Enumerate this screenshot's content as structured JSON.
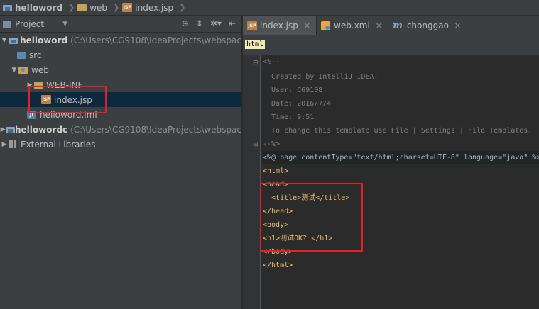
{
  "breadcrumb": {
    "items": [
      {
        "label": "helloword",
        "icon": "project-icon"
      },
      {
        "label": "web",
        "icon": "folder-icon"
      },
      {
        "label": "index.jsp",
        "icon": "jsp-file-icon"
      }
    ]
  },
  "project_panel": {
    "title": "Project",
    "tree": [
      {
        "label": "helloword",
        "path": "(C:\\Users\\CG9108\\IdeaProjects\\webspac",
        "expanded": true
      },
      {
        "label": "src"
      },
      {
        "label": "web",
        "expanded": true
      },
      {
        "label": "WEB-INF",
        "expanded": false
      },
      {
        "label": "index.jsp",
        "selected": true
      },
      {
        "label": "helloword.iml"
      },
      {
        "label": "hellowordc",
        "path": "(C:\\Users\\CG9108\\IdeaProjects\\webspac",
        "expanded": false
      },
      {
        "label": "External Libraries",
        "expanded": false
      }
    ]
  },
  "tabs": [
    {
      "label": "index.jsp",
      "active": true
    },
    {
      "label": "web.xml"
    },
    {
      "label": "chonggao"
    }
  ],
  "code_breadcrumb": "html",
  "code": {
    "lines": [
      "<%--",
      "  Created by IntelliJ IDEA.",
      "  User: CG9108",
      "  Date: 2016/7/4",
      "  Time: 9:51",
      "  To change this template use File | Settings | File Templates.",
      "--%>",
      "<%@ page contentType=\"text/html;charset=UTF-8\" language=\"java\" %>",
      "<html>",
      "<head>",
      "  <title>测试</title>",
      "</head>",
      "<body>",
      "<h1>测试OK? </h1>",
      "</body>",
      "</html>"
    ]
  },
  "colors": {
    "bg": "#3c3f41",
    "editor_bg": "#2b2b2b",
    "annotation_red": "#e2202a",
    "tag": "#e8bf6a",
    "string": "#6a8759",
    "comment": "#808080"
  }
}
